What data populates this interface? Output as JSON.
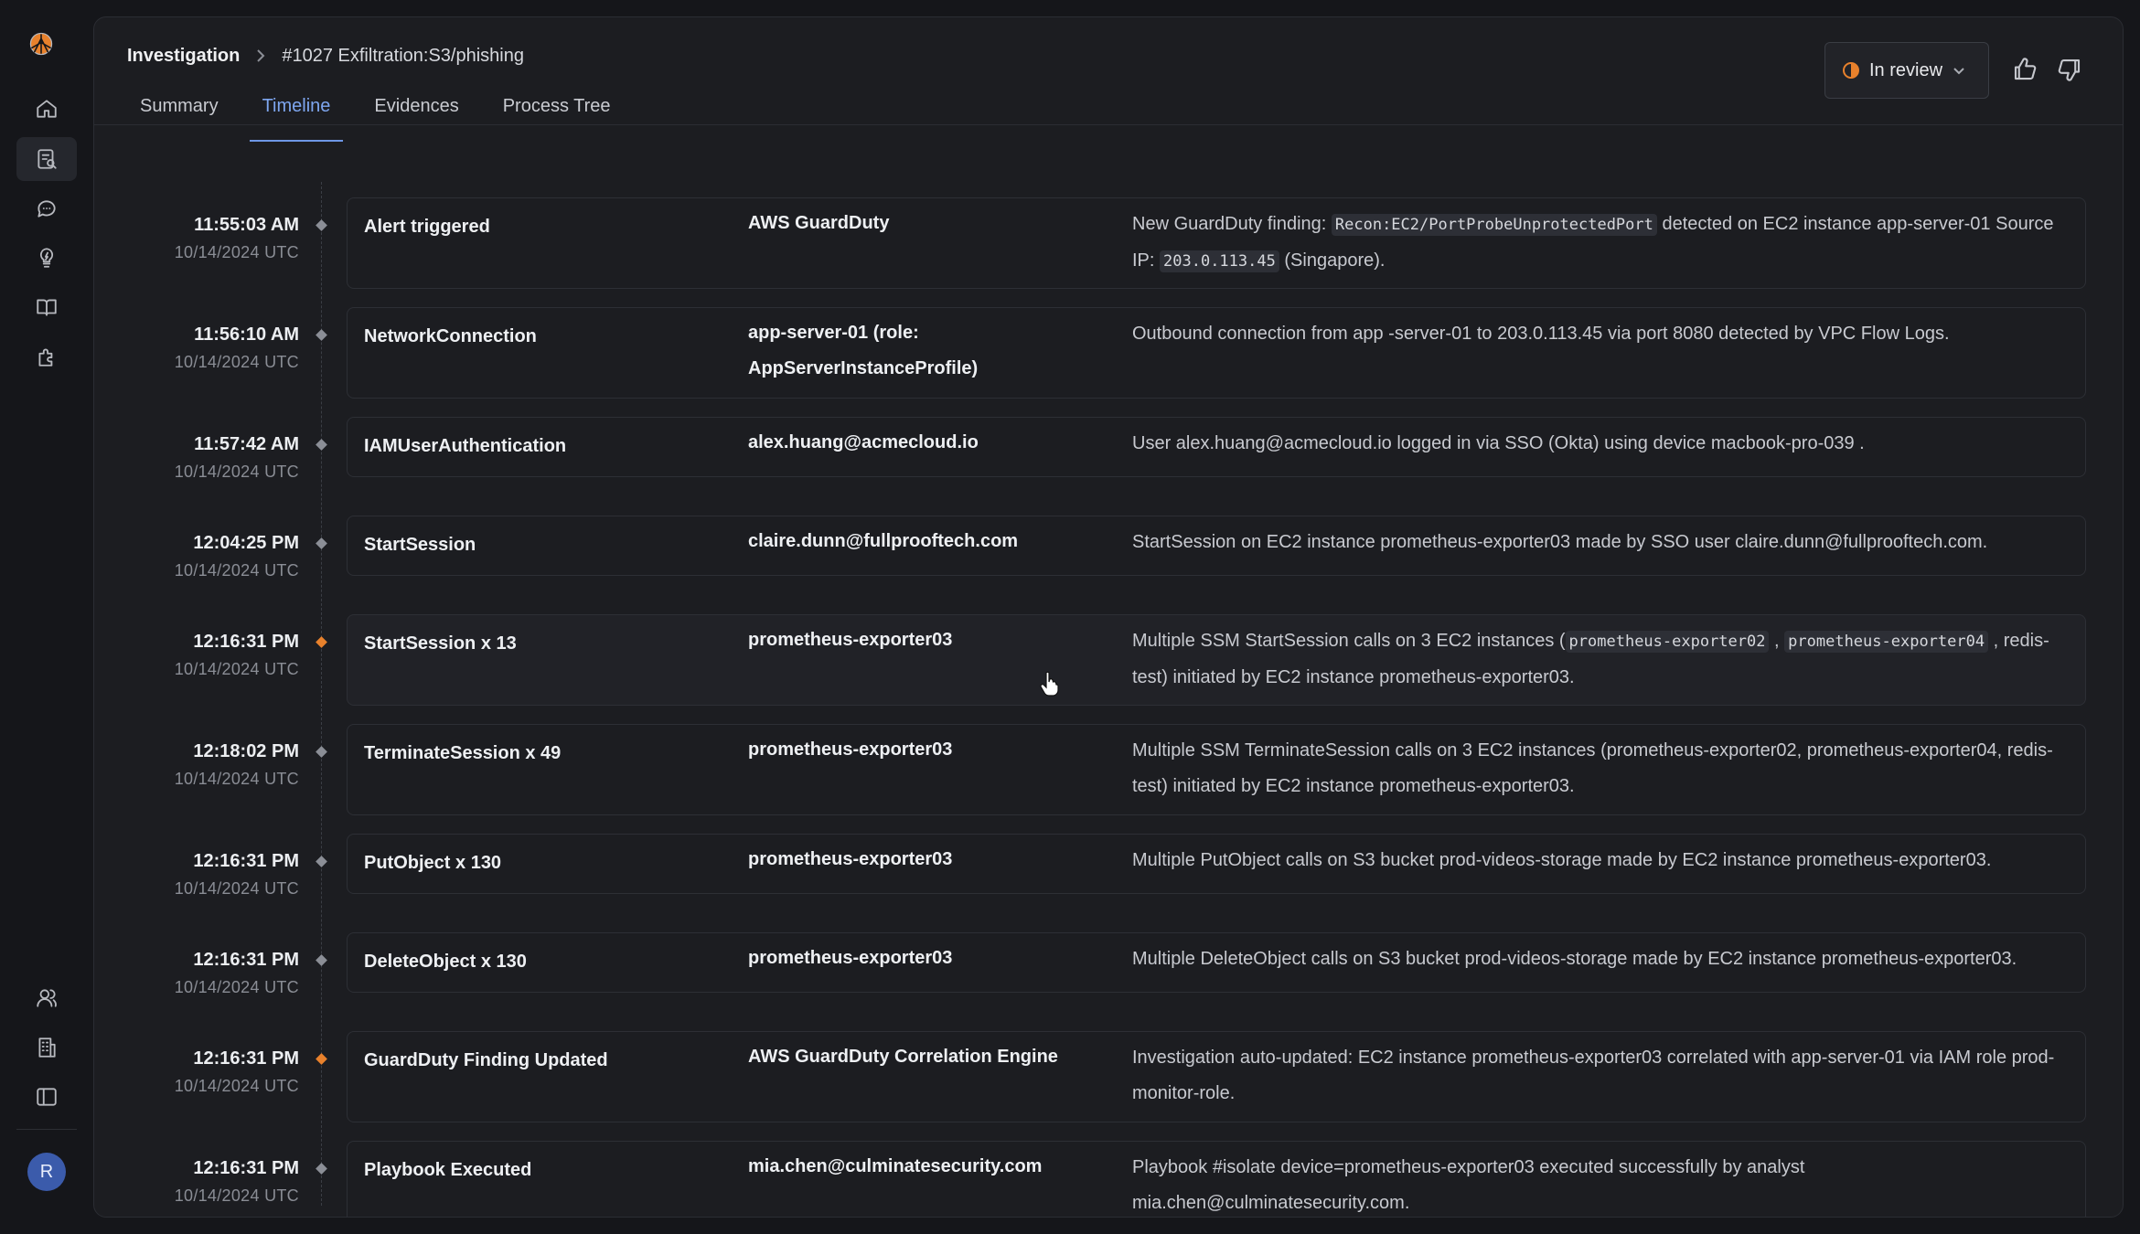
{
  "breadcrumb": {
    "root": "Investigation",
    "current": "#1027 Exfiltration:S3/phishing"
  },
  "tabs": [
    {
      "label": "Summary",
      "active": false
    },
    {
      "label": "Timeline",
      "active": true
    },
    {
      "label": "Evidences",
      "active": false
    },
    {
      "label": "Process Tree",
      "active": false
    }
  ],
  "status": {
    "label": "In review",
    "color": "#e8812c"
  },
  "user": {
    "avatar_initial": "R"
  },
  "colors": {
    "accent": "#6e97e6",
    "warning": "#e8812c"
  },
  "timeline": [
    {
      "time": "11:55:03 AM",
      "date": "10/14/2024 UTC",
      "marker": "neutral",
      "event": "Alert triggered",
      "actor": "AWS GuardDuty",
      "desc": [
        "New GuardDuty finding: ",
        {
          "code": "Recon:EC2/PortProbeUnprotectedPort"
        },
        " detected on EC2 instance app-server-01 Source IP: ",
        {
          "code": "203.0.113.45"
        },
        " (Singapore)."
      ]
    },
    {
      "time": "11:56:10 AM",
      "date": "10/14/2024 UTC",
      "marker": "neutral",
      "event": "NetworkConnection",
      "actor": "app-server-01 (role: AppServerInstanceProfile)",
      "desc": [
        "Outbound connection from app  -server-01 to 203.0.113.45 via port 8080 detected by VPC Flow Logs."
      ]
    },
    {
      "time": "11:57:42 AM",
      "date": "10/14/2024 UTC",
      "marker": "neutral",
      "event": "IAMUserAuthentication",
      "actor": "alex.huang@acmecloud.io",
      "desc": [
        "User alex.huang@acmecloud.io logged in via SSO (Okta) using device macbook-pro-039 ."
      ]
    },
    {
      "time": "12:04:25 PM",
      "date": "10/14/2024 UTC",
      "marker": "neutral",
      "event": "StartSession",
      "actor": "claire.dunn@fullprooftech.com",
      "desc": [
        "StartSession on EC2 instance prometheus-exporter03 made by SSO user claire.dunn@fullprooftech.com."
      ]
    },
    {
      "time": "12:16:31 PM",
      "date": "10/14/2024 UTC",
      "marker": "orange",
      "event": "StartSession x 13",
      "actor": "prometheus-exporter03",
      "desc": [
        "Multiple SSM StartSession calls on 3 EC2 instances (",
        {
          "code": "prometheus-exporter02"
        },
        " , ",
        {
          "code": "prometheus-exporter04"
        },
        " , redis-test) initiated by EC2 instance prometheus-exporter03."
      ]
    },
    {
      "time": "12:18:02 PM",
      "date": "10/14/2024 UTC",
      "marker": "neutral",
      "event": "TerminateSession x 49",
      "actor": "prometheus-exporter03",
      "desc": [
        "Multiple SSM TerminateSession calls on 3 EC2 instances (prometheus-exporter02, prometheus-exporter04, redis-test) initiated by EC2 instance prometheus-exporter03."
      ]
    },
    {
      "time": "12:16:31 PM",
      "date": "10/14/2024 UTC",
      "marker": "neutral",
      "event": "PutObject x 130",
      "actor": "prometheus-exporter03",
      "desc": [
        "Multiple PutObject calls on S3 bucket prod-videos-storage made by EC2 instance prometheus-exporter03."
      ]
    },
    {
      "time": "12:16:31 PM",
      "date": "10/14/2024 UTC",
      "marker": "neutral",
      "event": "DeleteObject x 130",
      "actor": "prometheus-exporter03",
      "desc": [
        "Multiple DeleteObject calls on S3 bucket prod-videos-storage made by EC2 instance prometheus-exporter03."
      ]
    },
    {
      "time": "12:16:31 PM",
      "date": "10/14/2024 UTC",
      "marker": "orange",
      "event": "GuardDuty Finding Updated",
      "actor": "AWS GuardDuty Correlation Engine",
      "desc": [
        "Investigation auto-updated: EC2 instance prometheus-exporter03 correlated with app-server-01 via IAM role prod-monitor-role."
      ]
    },
    {
      "time": "12:16:31 PM",
      "date": "10/14/2024 UTC",
      "marker": "neutral",
      "event": "Playbook Executed",
      "actor": "mia.chen@culminatesecurity.com",
      "desc": [
        "Playbook #isolate device=prometheus-exporter03 executed successfully by analyst mia.chen@culminatesecurity.com."
      ]
    }
  ]
}
